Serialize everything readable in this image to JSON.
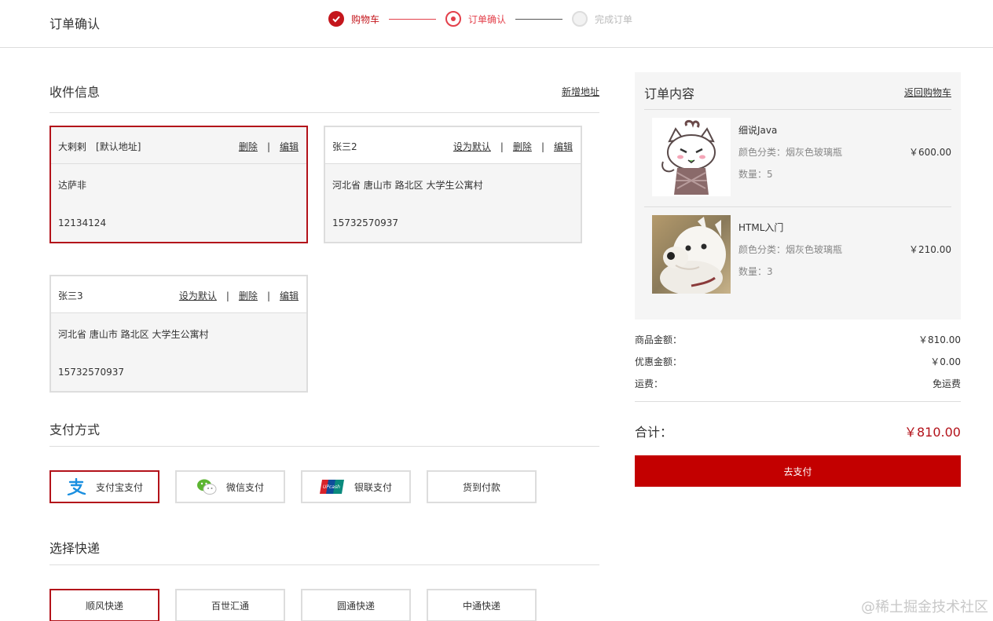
{
  "header": {
    "title": "订单确认",
    "steps": [
      {
        "label": "购物车",
        "state": "done"
      },
      {
        "label": "订单确认",
        "state": "current"
      },
      {
        "label": "完成订单",
        "state": "todo"
      }
    ]
  },
  "address": {
    "title": "收件信息",
    "add_link": "新增地址",
    "cards": [
      {
        "name": "大剌剌",
        "default_tag": "[默认地址]",
        "delete": "删除",
        "edit": "编辑",
        "address": "达萨非",
        "phone": "12134124"
      },
      {
        "name": "张三2",
        "set_default": "设为默认",
        "delete": "删除",
        "edit": "编辑",
        "address": "河北省 唐山市 路北区 大学生公寓村",
        "phone": "15732570937"
      },
      {
        "name": "张三3",
        "set_default": "设为默认",
        "delete": "删除",
        "edit": "编辑",
        "address": "河北省 唐山市 路北区 大学生公寓村",
        "phone": "15732570937"
      }
    ]
  },
  "payment": {
    "title": "支付方式",
    "options": [
      {
        "label": "支付宝支付",
        "icon": "alipay-icon"
      },
      {
        "label": "微信支付",
        "icon": "wechat-icon"
      },
      {
        "label": "银联支付",
        "icon": "unionpay-icon"
      },
      {
        "label": "货到付款"
      }
    ]
  },
  "shipping": {
    "title": "选择快递",
    "options": [
      "顺风快递",
      "百世汇通",
      "圆通快递",
      "中通快递"
    ]
  },
  "order": {
    "title": "订单内容",
    "back_link": "返回购物车",
    "items": [
      {
        "name": "细说Java",
        "spec": "颜色分类：烟灰色玻璃瓶",
        "qty": "数量：5",
        "price": "￥600.00"
      },
      {
        "name": "HTML入门",
        "spec": "颜色分类：烟灰色玻璃瓶",
        "qty": "数量：3",
        "price": "￥210.00"
      }
    ],
    "summary": [
      {
        "label": "商品金额：",
        "value": "￥810.00"
      },
      {
        "label": "优惠金额：",
        "value": "￥0.00"
      },
      {
        "label": "运费：",
        "value": "免运费"
      }
    ],
    "total_label": "合计：",
    "total_value": "￥810.00",
    "pay_button": "去支付"
  },
  "watermark": "@稀土掘金技术社区",
  "colors": {
    "accent": "#c4161c",
    "pay_button": "#c30000",
    "panel_bg": "#f5f5f5"
  }
}
